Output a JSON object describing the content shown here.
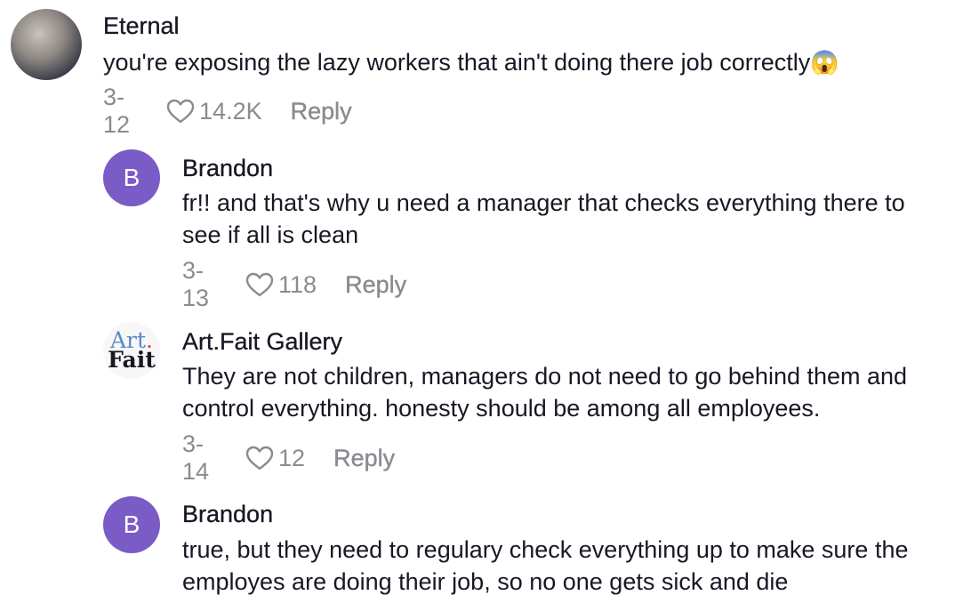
{
  "comments": [
    {
      "username": "Eternal",
      "text": "you're exposing the lazy workers that ain't doing there job correctly",
      "emoji": "😱",
      "date": "3-12",
      "likes": "14.2K",
      "reply_label": "Reply"
    },
    {
      "username": "Brandon",
      "avatar_letter": "B",
      "text": "fr!! and that's why u need a manager that checks everything there to see if all is clean",
      "date": "3-13",
      "likes": "118",
      "reply_label": "Reply"
    },
    {
      "username": "Art.Fait Gallery",
      "avatar_logo_top": "Art",
      "avatar_logo_dot": ".",
      "avatar_logo_bottom": "Fait",
      "text": "They are not children, managers do not need to go behind them and control everything. honesty should be among all employees.",
      "date": "3-14",
      "likes": "12",
      "reply_label": "Reply"
    },
    {
      "username": "Brandon",
      "avatar_letter": "B",
      "text": "true, but they need to regulary check everything up to make sure the employes are doing their job, so no one gets sick and die"
    }
  ],
  "icons": {
    "like": "heart-outline-icon"
  },
  "colors": {
    "avatar_bg": "#7b5cc6",
    "meta_text": "#8a8b91",
    "main_text": "#161823"
  }
}
